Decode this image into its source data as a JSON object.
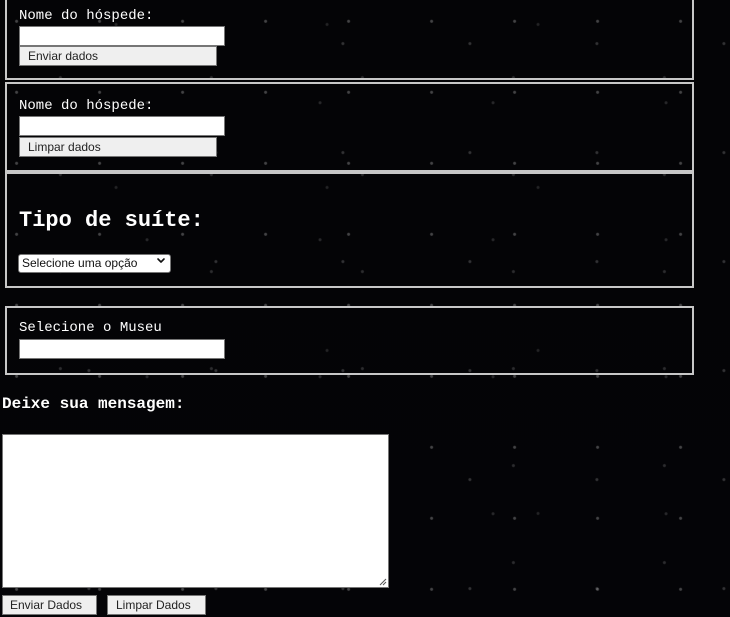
{
  "forms": {
    "guest_form_1": {
      "label": "Nome do hóspede:",
      "input_value": "",
      "button_label": "Enviar dados"
    },
    "guest_form_2": {
      "label": "Nome do hóspede:",
      "input_value": "",
      "button_label": "Limpar dados"
    },
    "suite": {
      "title": "Tipo de suíte:",
      "selected_option": "Selecione uma opção"
    },
    "museum": {
      "label": "Selecione o Museu",
      "input_value": ""
    },
    "message": {
      "title": "Deixe sua mensagem:",
      "textarea_value": ""
    },
    "actions": {
      "submit_label": "Enviar Dados",
      "clear_label": "Limpar Dados"
    }
  },
  "icons": {
    "select_arrow": "chevron-down-icon",
    "resize_handle": "resize-handle-icon"
  },
  "colors": {
    "background": "#040406",
    "text": "#ffffff",
    "border": "#c7c7c7"
  }
}
